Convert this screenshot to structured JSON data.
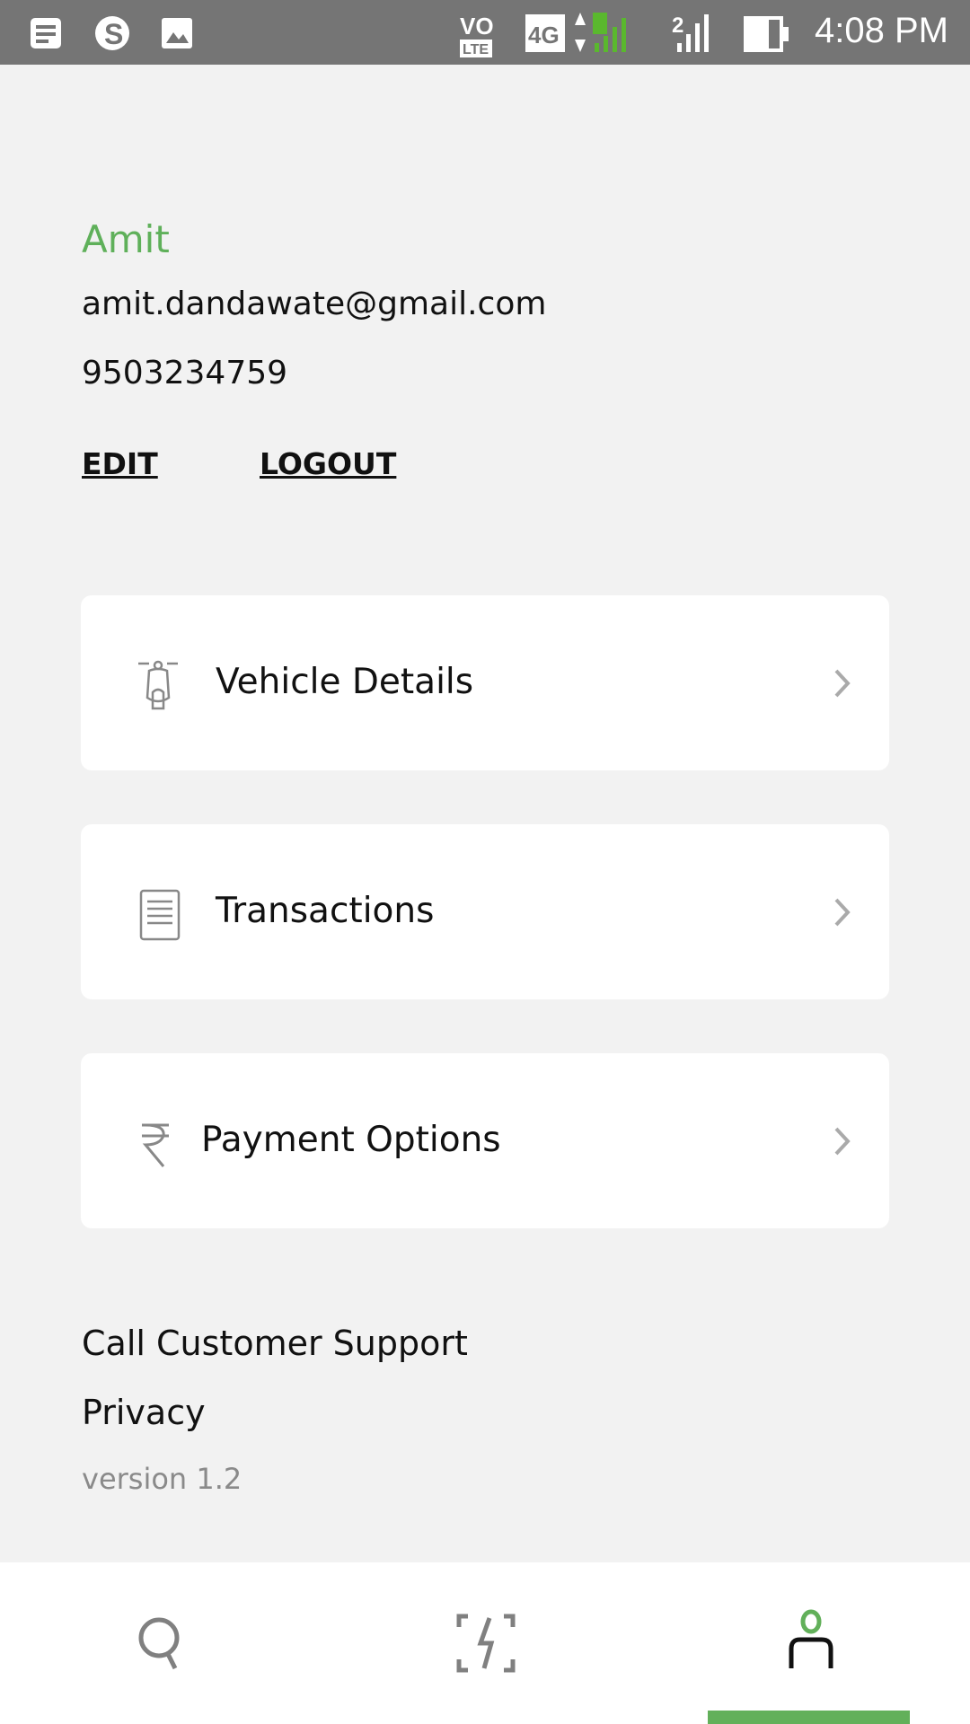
{
  "status_bar": {
    "time": "4:08 PM",
    "sim1": "1",
    "sim2": "2",
    "network": "4G",
    "volte": "VO LTE"
  },
  "profile": {
    "name": "Amit",
    "email": "amit.dandawate@gmail.com",
    "phone": "9503234759",
    "edit_label": "EDIT",
    "logout_label": "LOGOUT"
  },
  "menu": [
    {
      "label": "Vehicle Details",
      "icon": "scooter-icon"
    },
    {
      "label": "Transactions",
      "icon": "document-icon"
    },
    {
      "label": "Payment Options",
      "icon": "rupee-icon"
    }
  ],
  "footer": {
    "support": "Call Customer Support",
    "privacy": "Privacy",
    "version": "version 1.2"
  },
  "bottom_nav": {
    "items": [
      "search",
      "scan",
      "profile"
    ],
    "active": "profile"
  },
  "colors": {
    "accent": "#5fb05a",
    "status_bar": "#757575",
    "background": "#f2f2f2"
  }
}
